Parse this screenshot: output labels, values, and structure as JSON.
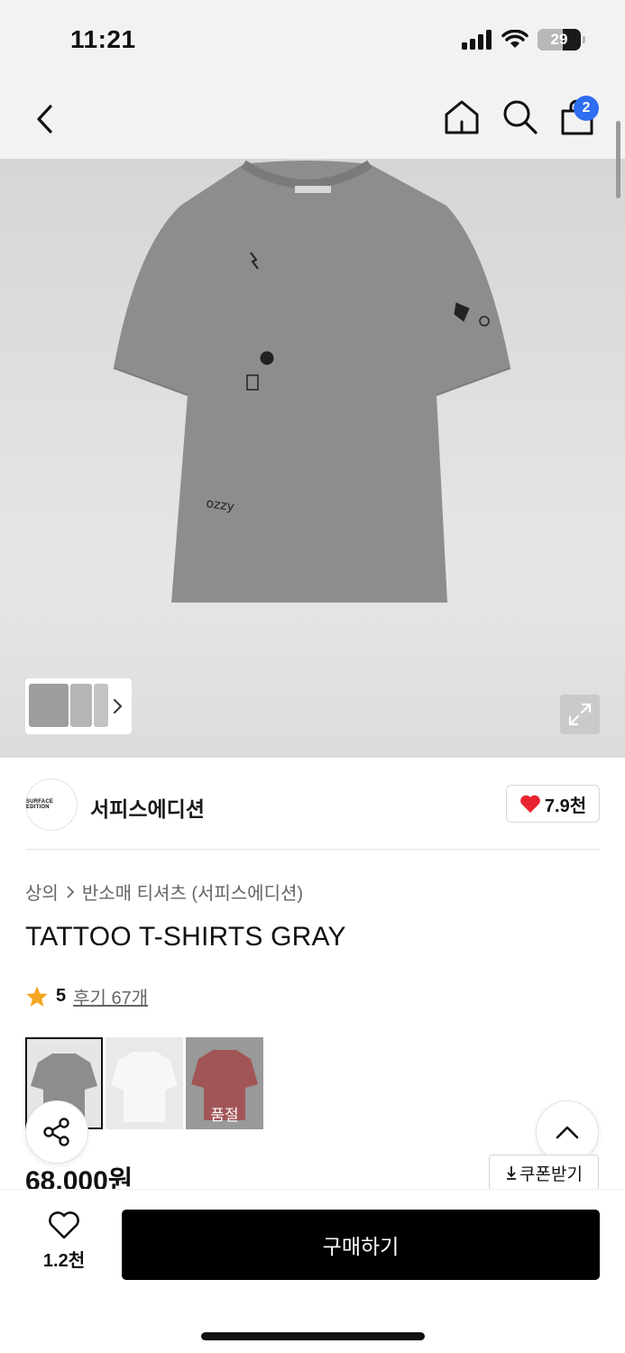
{
  "status_bar": {
    "time": "11:21",
    "battery": "29"
  },
  "nav": {
    "cart_count": "2",
    "icons": [
      "back-chevron-icon",
      "home-icon",
      "search-icon",
      "shopping-bag-icon"
    ]
  },
  "hero": {
    "icons": [
      "chevron-right-icon",
      "expand-icon"
    ]
  },
  "brand": {
    "logo_text": "SURFACE EDITION",
    "name": "서피스에디션",
    "likes": "7.9천"
  },
  "breadcrumb": {
    "category": "상의",
    "subcategory": "반소매 티셔츠 (서피스에디션)"
  },
  "product": {
    "title": "TATTOO T-SHIRTS GRAY",
    "rating": "5",
    "reviews": "후기 67개",
    "price": "68,000원",
    "swatches": [
      {
        "color": "gray",
        "selected": true
      },
      {
        "color": "white",
        "selected": false
      },
      {
        "color": "red",
        "label": "품절",
        "sold_out": true
      }
    ]
  },
  "coupon": {
    "label": "쿠폰받기"
  },
  "bottom": {
    "wish_count": "1.2천",
    "buy_label": "구매하기"
  },
  "colors": {
    "accent_blue": "#2f6df2",
    "heart_red": "#e8232f",
    "star": "#f5a623",
    "buy_bg": "#000000"
  }
}
